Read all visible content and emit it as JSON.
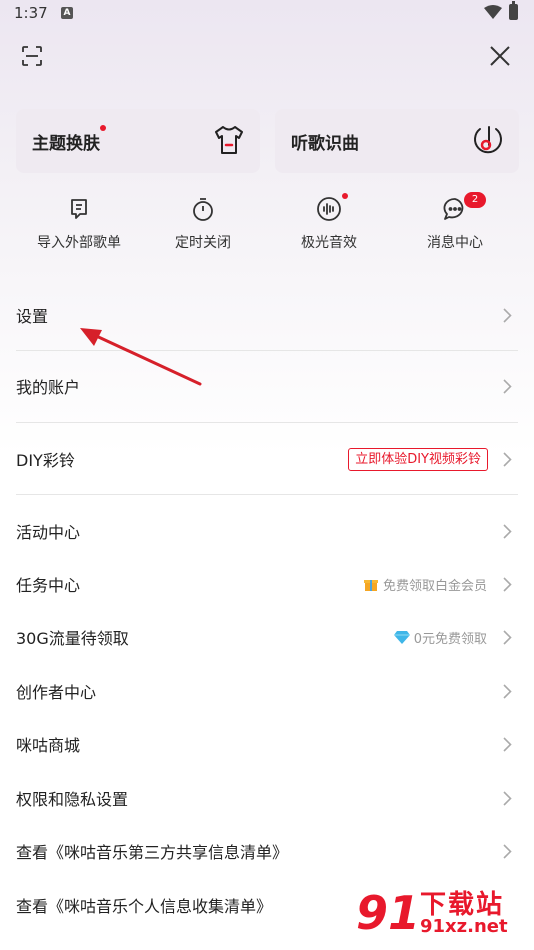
{
  "status_bar": {
    "time": "1:37",
    "notif_letter": "A"
  },
  "top_bar": {
    "scan_icon": "scan-icon",
    "close_icon": "close-icon"
  },
  "cards": [
    {
      "label": "主题换肤",
      "icon": "tshirt-icon",
      "has_dot": true
    },
    {
      "label": "听歌识曲",
      "icon": "music-recognize-icon",
      "has_dot": false
    }
  ],
  "quick_actions": [
    {
      "label": "导入外部歌单",
      "icon": "import-playlist-icon"
    },
    {
      "label": "定时关闭",
      "icon": "timer-icon"
    },
    {
      "label": "极光音效",
      "icon": "sound-effect-icon",
      "has_dot": true
    },
    {
      "label": "消息中心",
      "icon": "message-icon",
      "badge": "2"
    }
  ],
  "menu": [
    {
      "label": "设置"
    },
    {
      "label": "我的账户"
    },
    {
      "label": "DIY彩铃",
      "pill": "立即体验DIY视频彩铃"
    },
    {
      "label": "活动中心"
    },
    {
      "label": "任务中心",
      "hint": "免费领取白金会员",
      "hint_icon": "gift-icon"
    },
    {
      "label": "30G流量待领取",
      "hint": "0元免费领取",
      "hint_icon": "diamond-icon"
    },
    {
      "label": "创作者中心"
    },
    {
      "label": "咪咕商城"
    },
    {
      "label": "权限和隐私设置"
    },
    {
      "label": "查看《咪咕音乐第三方共享信息清单》"
    },
    {
      "label": "查看《咪咕音乐个人信息收集清单》"
    }
  ],
  "watermark": {
    "brand": "91",
    "cn": "下载站",
    "url": "91xz.net"
  },
  "colors": {
    "accent": "#e8192c",
    "card_bg": "#efeaf1",
    "arrow": "#d6202a"
  }
}
